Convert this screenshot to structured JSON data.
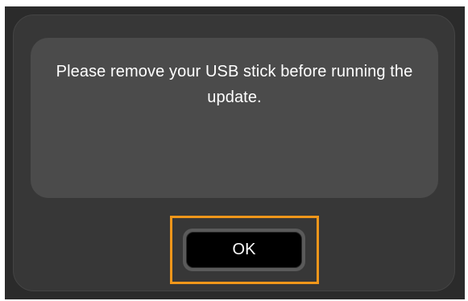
{
  "dialog": {
    "message": "Please remove your USB stick before running the update.",
    "ok_label": "OK"
  },
  "colors": {
    "frame_bg": "#2b2b2b",
    "dialog_bg": "#373737",
    "panel_bg": "#4b4b4b",
    "focus_accent": "#f0961a",
    "button_bg": "#000000",
    "text": "#ffffff"
  }
}
